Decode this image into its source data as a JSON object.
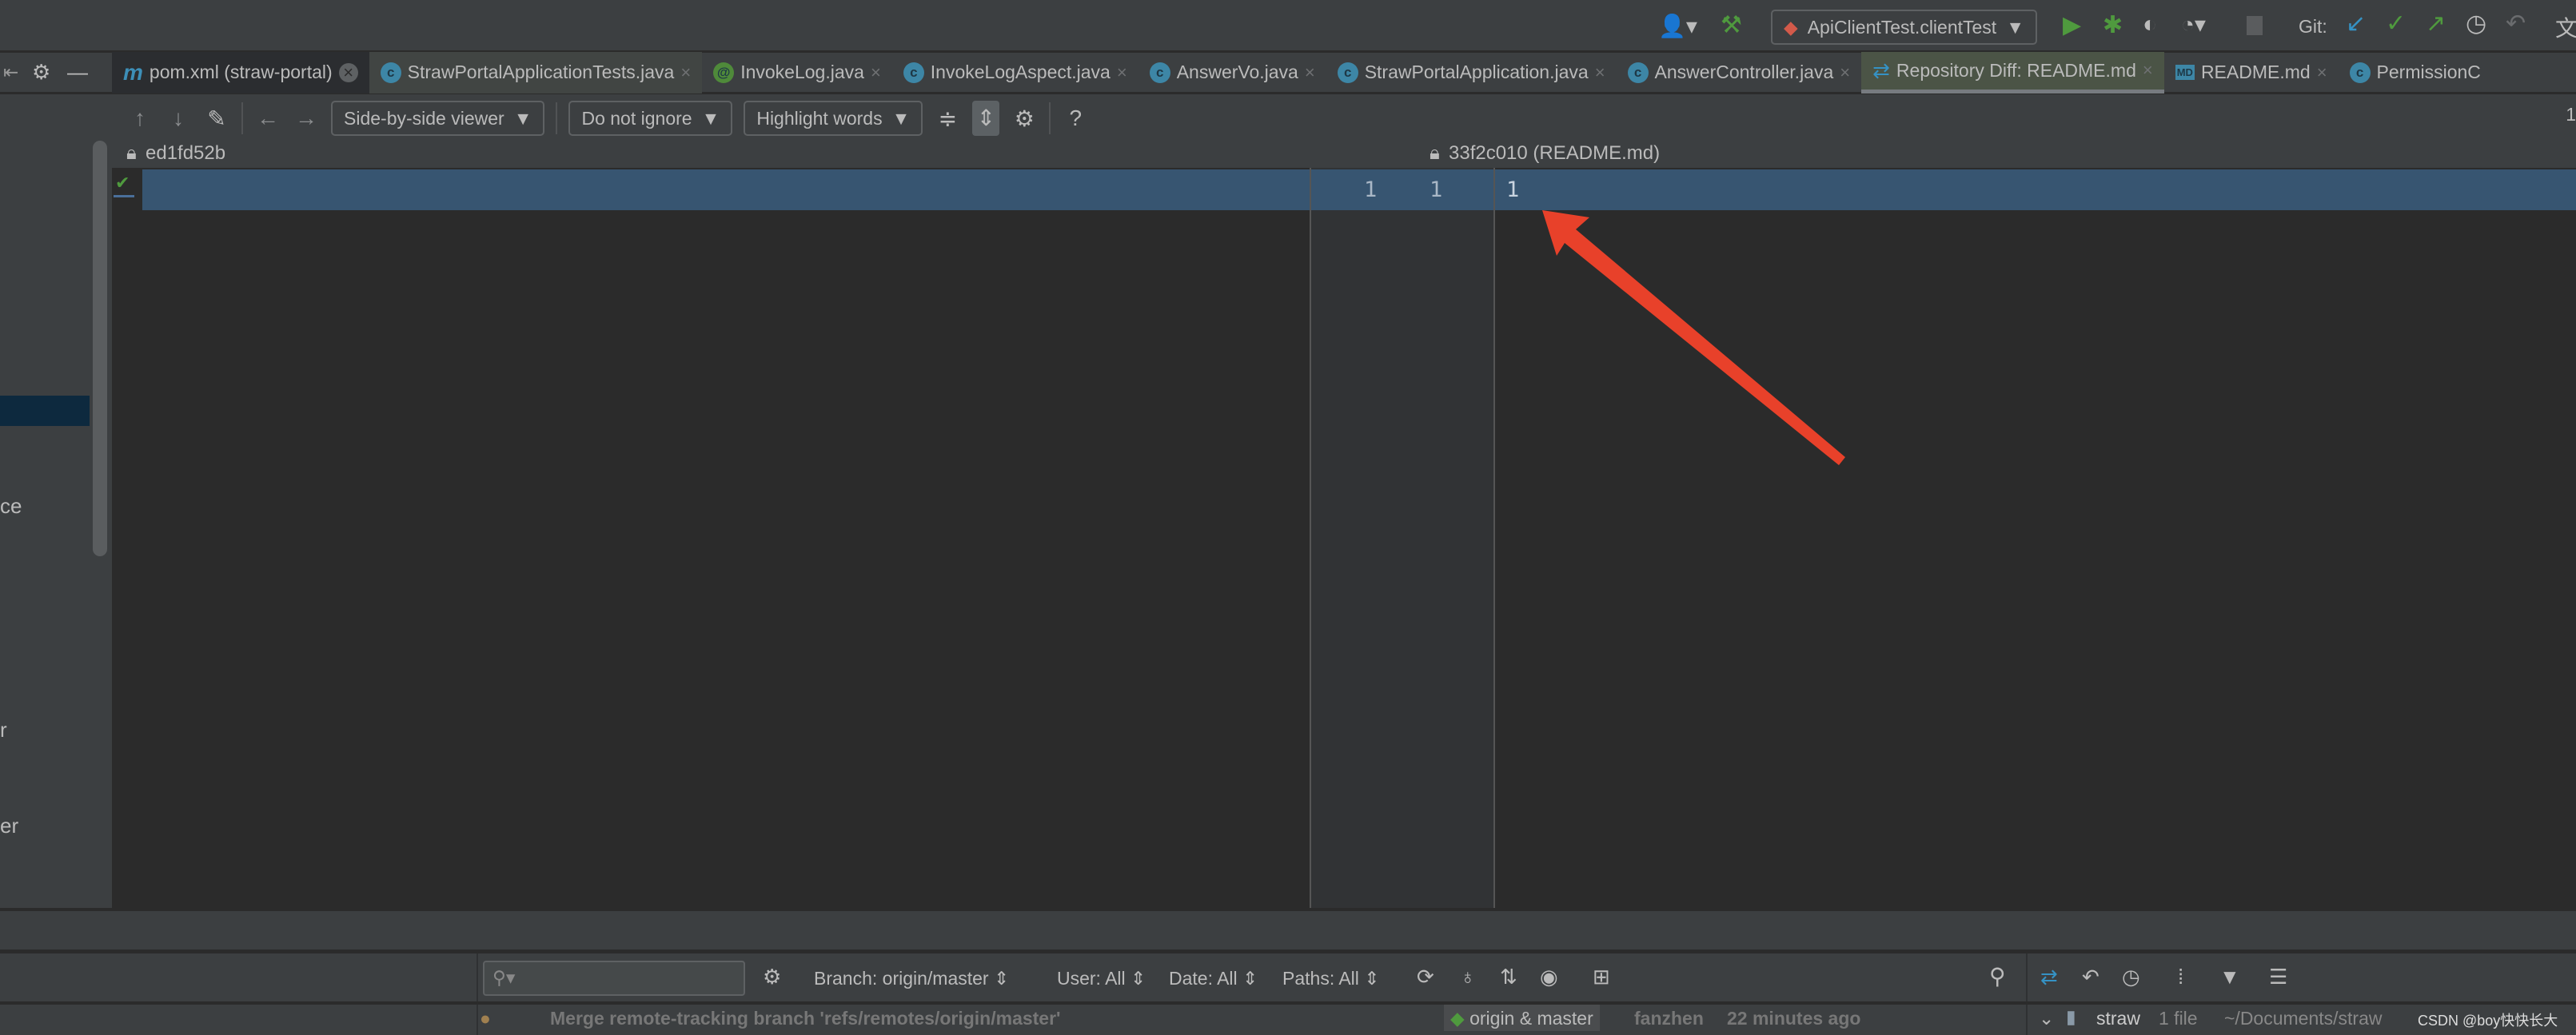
{
  "toolbar": {
    "run_config": "ApiClientTest.clientTest",
    "git_label": "Git:",
    "right_glyph": "文"
  },
  "tabs": [
    {
      "label": "pom.xml (straw-portal)",
      "icon": "m"
    },
    {
      "label": "StrawPortalApplicationTests.java",
      "icon": "c"
    },
    {
      "label": "InvokeLog.java",
      "icon": "@"
    },
    {
      "label": "InvokeLogAspect.java",
      "icon": "c"
    },
    {
      "label": "AnswerVo.java",
      "icon": "c"
    },
    {
      "label": "StrawPortalApplication.java",
      "icon": "c"
    },
    {
      "label": "AnswerController.java",
      "icon": "c"
    },
    {
      "label": "Repository Diff: README.md",
      "icon": "diff"
    },
    {
      "label": "README.md",
      "icon": "MD"
    },
    {
      "label": "PermissionC",
      "icon": "c"
    }
  ],
  "diff": {
    "viewer": "Side-by-side viewer",
    "ignore": "Do not ignore",
    "highlight": "Highlight words",
    "help": "?",
    "right_counter": "1",
    "left_revision": "ed1fd52b",
    "right_revision": "33f2c010 (README.md)",
    "gutter_left": "1",
    "gutter_right": "1",
    "right_line": "1"
  },
  "project_fragments": [
    "ce",
    "r",
    "er"
  ],
  "log": {
    "branch": "Branch: origin/master",
    "user": "User: All",
    "date": "Date: All",
    "paths": "Paths: All",
    "commit_message": "Merge remote-tracking branch 'refs/remotes/origin/master'",
    "commit_refs": "origin & master",
    "commit_author": "fanzhen",
    "commit_time": "22 minutes ago",
    "changes_root": "straw",
    "changes_count": "1 file",
    "changes_path": "~/Documents/straw"
  },
  "watermark": "CSDN @boy快快长大",
  "colors": {
    "accent": "#375571",
    "annotation": "#e8412a"
  }
}
